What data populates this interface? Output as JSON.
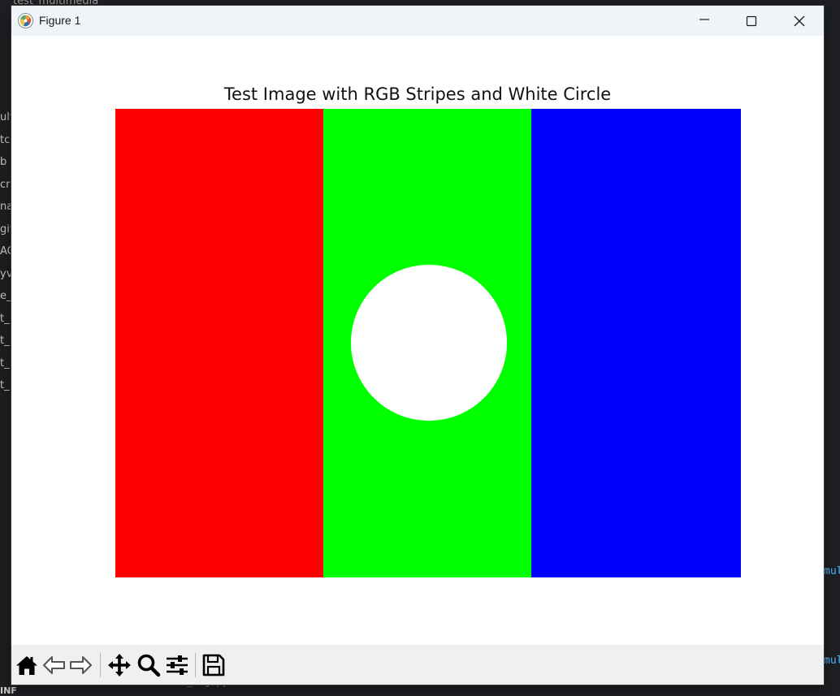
{
  "background_ide": {
    "top_text": "test_multimedia",
    "left_fragments": [
      "ult",
      "tc",
      "b",
      "cri",
      "na",
      "git",
      "AC",
      "yv",
      "e_",
      "t_",
      "t_",
      "t_",
      "t_"
    ],
    "right_text_1": "mul",
    "right_text_2": "mul",
    "bottom_label": "INF",
    "bottom_code": "_img.py"
  },
  "window": {
    "title": "Figure 1",
    "controls": {
      "minimize": "minimize",
      "maximize": "maximize",
      "close": "close"
    }
  },
  "figure": {
    "title": "Test Image with RGB Stripes and White Circle",
    "stripe_colors": [
      "#ff0000",
      "#00ff00",
      "#0000ff"
    ],
    "circle_color": "#ffffff"
  },
  "toolbar": {
    "tools": [
      {
        "name": "home",
        "icon": "home-icon"
      },
      {
        "name": "back",
        "icon": "back-arrow-icon"
      },
      {
        "name": "forward",
        "icon": "forward-arrow-icon"
      },
      {
        "name": "pan",
        "icon": "move-icon"
      },
      {
        "name": "zoom",
        "icon": "magnifier-icon"
      },
      {
        "name": "configure-subplots",
        "icon": "sliders-icon"
      },
      {
        "name": "save",
        "icon": "floppy-disk-icon"
      }
    ]
  }
}
